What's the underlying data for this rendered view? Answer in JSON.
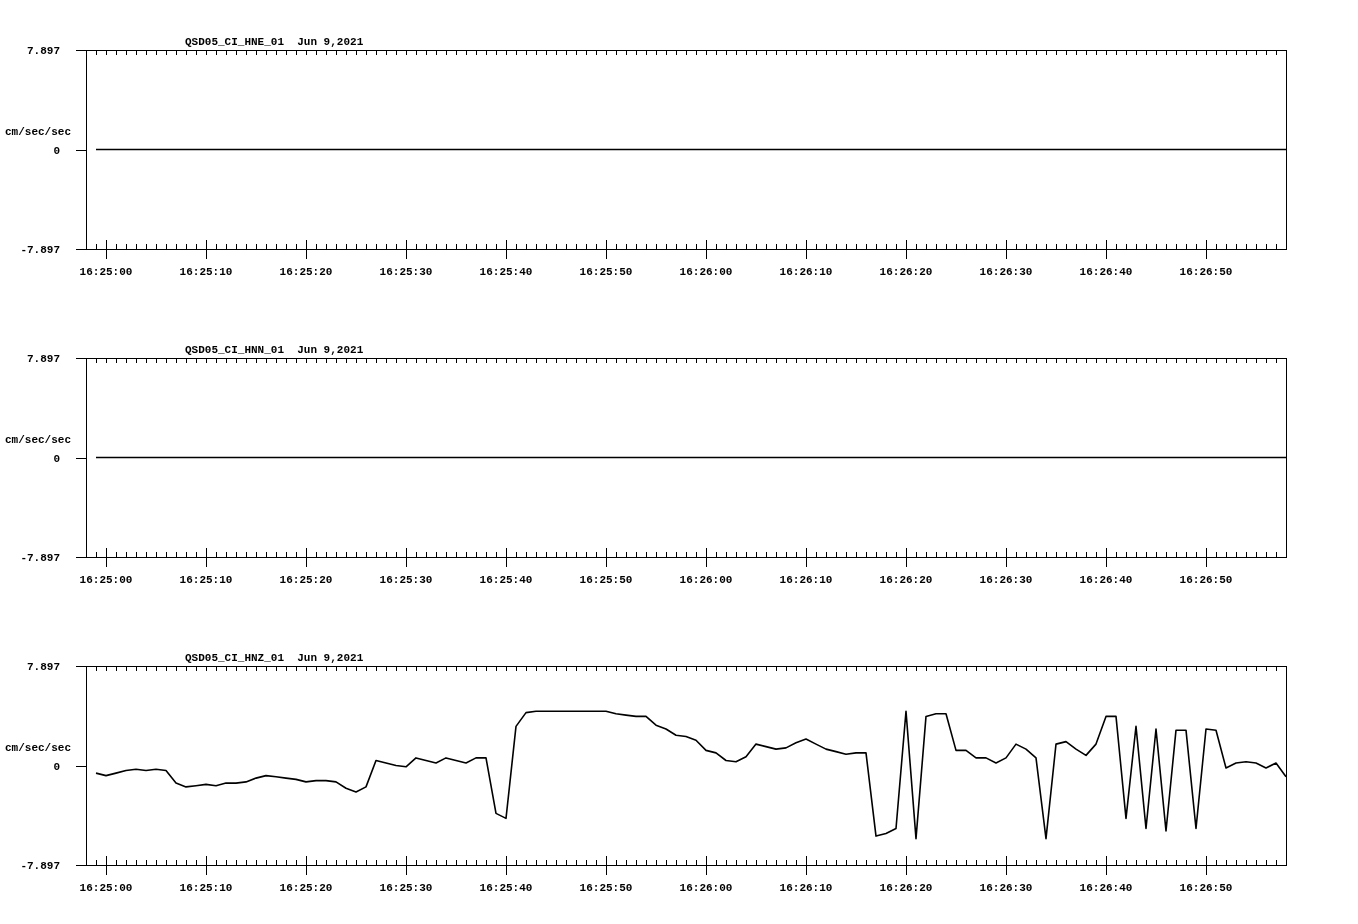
{
  "plots": [
    {
      "chart_data": {
        "type": "line",
        "title": "QSD05_CI_HNE_01  Jun 9,2021",
        "ylabel": "cm/sec/sec",
        "xlim": [
          59098,
          59218
        ],
        "ylim": [
          -7.897,
          7.897
        ],
        "yticks": [
          {
            "value": 7.897,
            "label": "7.897"
          },
          {
            "value": 0,
            "label": "0"
          },
          {
            "value": -7.897,
            "label": "-7.897"
          }
        ],
        "xticks": [
          {
            "value": 59100,
            "label": "16:25:00"
          },
          {
            "value": 59110,
            "label": "16:25:10"
          },
          {
            "value": 59120,
            "label": "16:25:20"
          },
          {
            "value": 59130,
            "label": "16:25:30"
          },
          {
            "value": 59140,
            "label": "16:25:40"
          },
          {
            "value": 59150,
            "label": "16:25:50"
          },
          {
            "value": 59160,
            "label": "16:26:00"
          },
          {
            "value": 59170,
            "label": "16:26:10"
          },
          {
            "value": 59180,
            "label": "16:26:20"
          },
          {
            "value": 59190,
            "label": "16:26:30"
          },
          {
            "value": 59200,
            "label": "16:26:40"
          },
          {
            "value": 59210,
            "label": "16:26:50"
          }
        ],
        "x": [
          59099,
          59218
        ],
        "series": [
          {
            "color": "#000000",
            "values": [
              0,
              0
            ]
          }
        ]
      }
    },
    {
      "chart_data": {
        "type": "line",
        "title": "QSD05_CI_HNN_01  Jun 9,2021",
        "ylabel": "cm/sec/sec",
        "xlim": [
          59098,
          59218
        ],
        "ylim": [
          -7.897,
          7.897
        ],
        "yticks": [
          {
            "value": 7.897,
            "label": "7.897"
          },
          {
            "value": 0,
            "label": "0"
          },
          {
            "value": -7.897,
            "label": "-7.897"
          }
        ],
        "xticks": [
          {
            "value": 59100,
            "label": "16:25:00"
          },
          {
            "value": 59110,
            "label": "16:25:10"
          },
          {
            "value": 59120,
            "label": "16:25:20"
          },
          {
            "value": 59130,
            "label": "16:25:30"
          },
          {
            "value": 59140,
            "label": "16:25:40"
          },
          {
            "value": 59150,
            "label": "16:25:50"
          },
          {
            "value": 59160,
            "label": "16:26:00"
          },
          {
            "value": 59170,
            "label": "16:26:10"
          },
          {
            "value": 59180,
            "label": "16:26:20"
          },
          {
            "value": 59190,
            "label": "16:26:30"
          },
          {
            "value": 59200,
            "label": "16:26:40"
          },
          {
            "value": 59210,
            "label": "16:26:50"
          }
        ],
        "x": [
          59099,
          59218
        ],
        "series": [
          {
            "color": "#000000",
            "values": [
              0,
              0
            ]
          }
        ]
      }
    },
    {
      "chart_data": {
        "type": "line",
        "title": "QSD05_CI_HNZ_01  Jun 9,2021",
        "ylabel": "cm/sec/sec",
        "xlim": [
          59098,
          59218
        ],
        "ylim": [
          -7.897,
          7.897
        ],
        "yticks": [
          {
            "value": 7.897,
            "label": "7.897"
          },
          {
            "value": 0,
            "label": "0"
          },
          {
            "value": -7.897,
            "label": "-7.897"
          }
        ],
        "xticks": [
          {
            "value": 59100,
            "label": "16:25:00"
          },
          {
            "value": 59110,
            "label": "16:25:10"
          },
          {
            "value": 59120,
            "label": "16:25:20"
          },
          {
            "value": 59130,
            "label": "16:25:30"
          },
          {
            "value": 59140,
            "label": "16:25:40"
          },
          {
            "value": 59150,
            "label": "16:25:50"
          },
          {
            "value": 59160,
            "label": "16:26:00"
          },
          {
            "value": 59170,
            "label": "16:26:10"
          },
          {
            "value": 59180,
            "label": "16:26:20"
          },
          {
            "value": 59190,
            "label": "16:26:30"
          },
          {
            "value": 59200,
            "label": "16:26:40"
          },
          {
            "value": 59210,
            "label": "16:26:50"
          }
        ],
        "x": [
          59099,
          59100,
          59101,
          59102,
          59103,
          59104,
          59105,
          59106,
          59107,
          59108,
          59109,
          59110,
          59111,
          59112,
          59113,
          59114,
          59115,
          59116,
          59117,
          59118,
          59119,
          59120,
          59121,
          59122,
          59123,
          59124,
          59125,
          59126,
          59127,
          59128,
          59129,
          59130,
          59131,
          59132,
          59133,
          59134,
          59135,
          59136,
          59137,
          59138,
          59139,
          59140,
          59141,
          59142,
          59143,
          59144,
          59145,
          59146,
          59147,
          59148,
          59149,
          59150,
          59151,
          59152,
          59153,
          59154,
          59155,
          59156,
          59157,
          59158,
          59159,
          59160,
          59161,
          59162,
          59163,
          59164,
          59165,
          59166,
          59167,
          59168,
          59169,
          59170,
          59171,
          59172,
          59173,
          59174,
          59175,
          59176,
          59177,
          59178,
          59179,
          59180,
          59181,
          59182,
          59183,
          59184,
          59185,
          59186,
          59187,
          59188,
          59189,
          59190,
          59191,
          59192,
          59193,
          59194,
          59195,
          59196,
          59197,
          59198,
          59199,
          59200,
          59201,
          59202,
          59203,
          59204,
          59205,
          59206,
          59207,
          59208,
          59209,
          59210,
          59211,
          59212,
          59213,
          59214,
          59215,
          59216,
          59217,
          59218
        ],
        "series": [
          {
            "color": "#000000",
            "values": [
              -0.6,
              -0.8,
              -0.6,
              -0.4,
              -0.3,
              -0.4,
              -0.3,
              -0.4,
              -1.4,
              -1.7,
              -1.6,
              -1.5,
              -1.6,
              -1.4,
              -1.4,
              -1.3,
              -1.0,
              -0.8,
              -0.9,
              -1.0,
              -1.1,
              -1.3,
              -1.2,
              -1.2,
              -1.3,
              -1.8,
              -2.1,
              -1.7,
              0.4,
              0.2,
              0,
              -0.1,
              0.6,
              0.4,
              0.2,
              0.6,
              0.4,
              0.2,
              0.6,
              0.6,
              -3.8,
              -4.2,
              3.1,
              4.2,
              4.3,
              4.3,
              4.3,
              4.3,
              4.3,
              4.3,
              4.3,
              4.3,
              4.1,
              4.0,
              3.9,
              3.9,
              3.2,
              2.9,
              2.4,
              2.3,
              2.0,
              1.2,
              1.0,
              0.4,
              0.3,
              0.7,
              1.7,
              1.5,
              1.3,
              1.4,
              1.8,
              2.1,
              1.7,
              1.3,
              1.1,
              0.9,
              1.0,
              1.0,
              -5.6,
              -5.4,
              -5.0,
              4.3,
              -5.8,
              3.9,
              4.1,
              4.1,
              1.2,
              1.2,
              0.6,
              0.6,
              0.2,
              0.6,
              1.7,
              1.3,
              0.6,
              -5.8,
              1.7,
              1.9,
              1.3,
              0.8,
              1.7,
              3.9,
              3.9,
              -4.2,
              3.1,
              -5.0,
              2.9,
              -5.2,
              2.8,
              2.8,
              -5.0,
              2.9,
              2.8,
              -0.2,
              0.2,
              0.3,
              0.2,
              -0.2,
              0.2,
              -0.9
            ]
          }
        ]
      }
    }
  ]
}
